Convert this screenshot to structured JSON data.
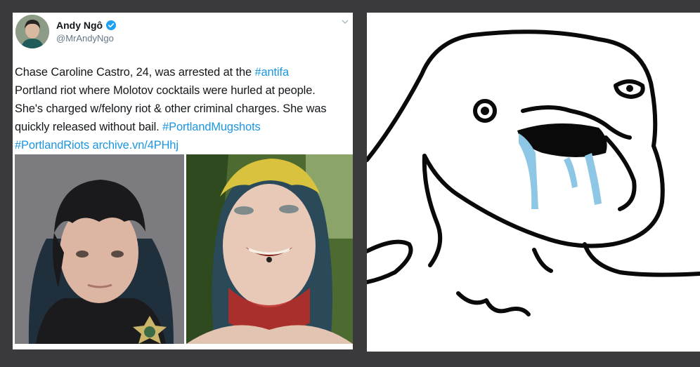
{
  "tweet": {
    "author_name": "Andy Ngô",
    "handle": "@MrAndyNgo",
    "lines": [
      [
        "Chase Caroline Castro, 24, was arrested at the ",
        "#antifa"
      ],
      [
        "Portland riot where Molotov cocktails were hurled at people.",
        ""
      ],
      [
        "She's charged w/felony riot & other criminal charges. She was",
        ""
      ],
      [
        "quickly released without bail. ",
        "#PortlandMugshots"
      ],
      [
        "",
        "#PortlandRiots archive.vn/4PHhj"
      ]
    ],
    "icons": {
      "verified": "verified-badge-icon",
      "menu": "chevron-down-icon"
    }
  },
  "photos": {
    "mugshot": "mugshot-photo",
    "selfie": "selfie-photo"
  },
  "meme": {
    "drawing": "crying-wojak-drawing"
  },
  "colors": {
    "background": "#3a3a3c",
    "link": "#1b95e0",
    "verified": "#1da1f2",
    "tears": "#8ec6e6"
  }
}
